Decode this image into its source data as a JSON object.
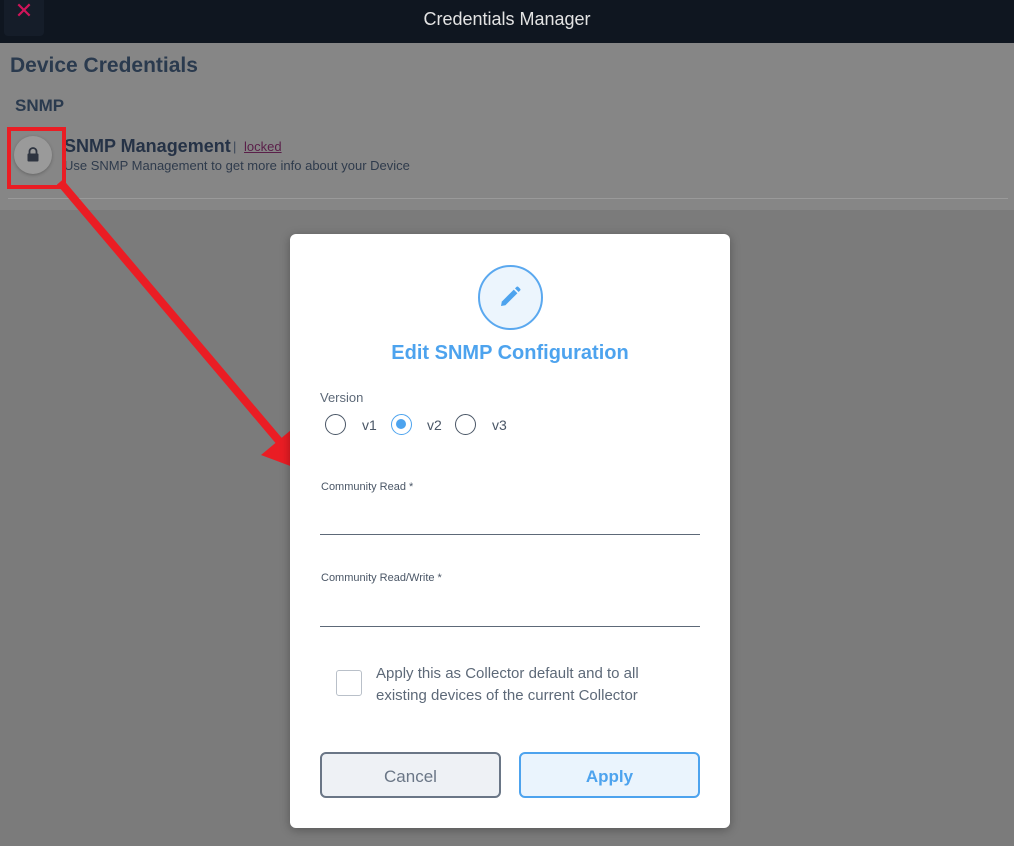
{
  "topbar": {
    "title": "Credentials Manager",
    "close_glyph": "✕"
  },
  "page": {
    "title": "Device Credentials",
    "section": "SNMP",
    "item": {
      "name": "SNMP Management",
      "separator": "|",
      "status": "locked",
      "description": "Use SNMP Management to get more info about your Device",
      "icon": "lock-icon"
    }
  },
  "modal": {
    "icon": "pencil-icon",
    "title": "Edit SNMP Configuration",
    "version_label": "Version",
    "versions": [
      "v1",
      "v2",
      "v3"
    ],
    "selected_version": "v2",
    "community_read_label": "Community Read *",
    "community_read_value": "",
    "community_rw_label": "Community Read/Write *",
    "community_rw_value": "",
    "apply_default_label": "Apply this as Collector default and to all existing devices of the current Collector",
    "apply_default_checked": false,
    "cancel_label": "Cancel",
    "apply_label": "Apply"
  },
  "colors": {
    "accent": "#4da3ee",
    "annotation": "#ea1d24",
    "topbar": "#0f1620",
    "close": "#d2145a"
  }
}
